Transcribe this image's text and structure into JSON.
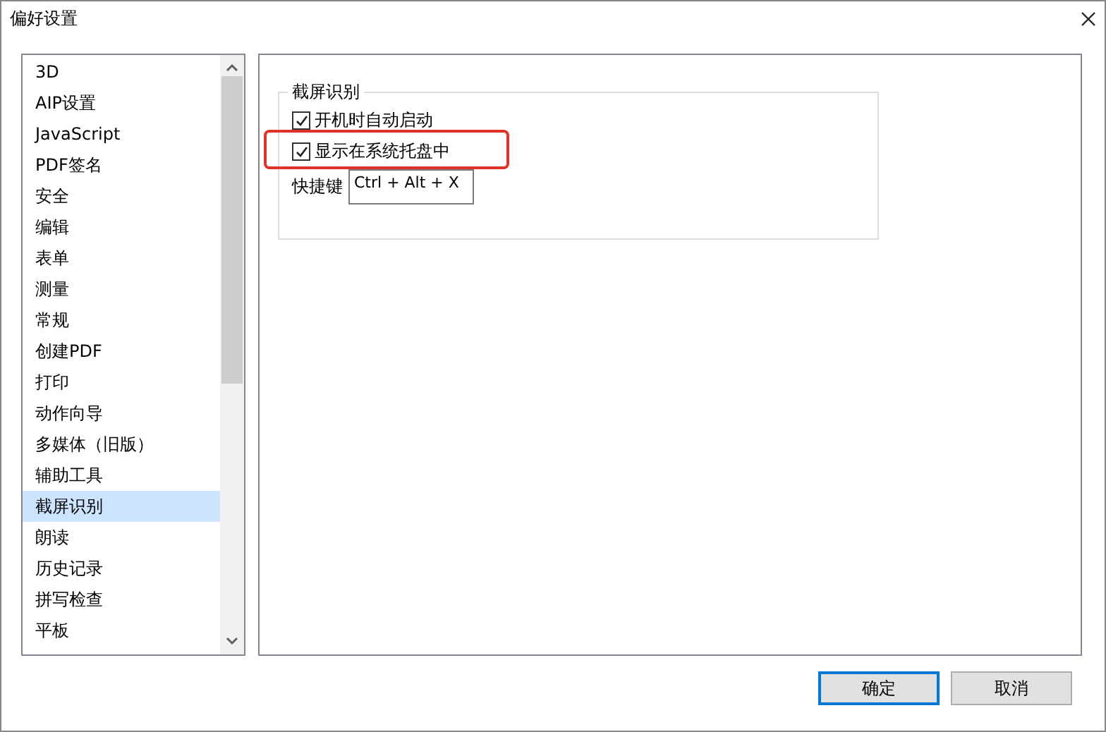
{
  "window": {
    "title": "偏好设置"
  },
  "sidebar": {
    "items": [
      {
        "label": "3D",
        "selected": false
      },
      {
        "label": "AIP设置",
        "selected": false
      },
      {
        "label": "JavaScript",
        "selected": false
      },
      {
        "label": "PDF签名",
        "selected": false
      },
      {
        "label": "安全",
        "selected": false
      },
      {
        "label": "编辑",
        "selected": false
      },
      {
        "label": "表单",
        "selected": false
      },
      {
        "label": "测量",
        "selected": false
      },
      {
        "label": "常规",
        "selected": false
      },
      {
        "label": "创建PDF",
        "selected": false
      },
      {
        "label": "打印",
        "selected": false
      },
      {
        "label": "动作向导",
        "selected": false
      },
      {
        "label": "多媒体（旧版）",
        "selected": false
      },
      {
        "label": "辅助工具",
        "selected": false
      },
      {
        "label": "截屏识别",
        "selected": true
      },
      {
        "label": "朗读",
        "selected": false
      },
      {
        "label": "历史记录",
        "selected": false
      },
      {
        "label": "拼写检查",
        "selected": false
      },
      {
        "label": "平板",
        "selected": false
      }
    ]
  },
  "group": {
    "title": "截屏识别",
    "options": [
      {
        "label": "开机时自动启动",
        "checked": true,
        "highlighted": false
      },
      {
        "label": "显示在系统托盘中",
        "checked": true,
        "highlighted": true
      }
    ],
    "shortcut": {
      "label": "快捷键",
      "value": "Ctrl + Alt + X"
    }
  },
  "buttons": [
    {
      "label": "确定",
      "default": true
    },
    {
      "label": "取消",
      "default": false
    }
  ]
}
